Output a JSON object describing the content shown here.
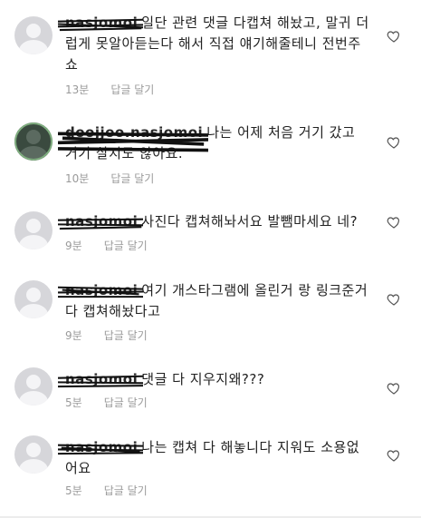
{
  "comments": [
    {
      "username": "nasjomoi",
      "text": "일단 관련 댓글 다캡쳐 해놨고, 말귀 더럽게 못알아듣는다 해서 직접 얘기해줄테니 전번주쇼",
      "time": "13분",
      "reply": "답글 달기",
      "avatar": "default-avatar"
    },
    {
      "username": "doojjoo.nasjomoi",
      "text": "나는 어제 처음 거기 갔고 거기 살지도 않아요.",
      "time": "10분",
      "reply": "답글 달기",
      "avatar": "photo-avatar"
    },
    {
      "username": "nasjomoi",
      "text": "사진다 캡쳐해놔서요 발뺌마세요 네?",
      "time": "9분",
      "reply": "답글 달기",
      "avatar": "default-avatar"
    },
    {
      "username": "nasjomoi",
      "text": "여기 개스타그램에 올린거 랑 링크준거 다 캡쳐해놨다고",
      "time": "9분",
      "reply": "답글 달기",
      "avatar": "default-avatar"
    },
    {
      "username": "nasjomoi",
      "text": "댓글 다 지우지왜???",
      "time": "5분",
      "reply": "답글 달기",
      "avatar": "default-avatar"
    },
    {
      "username": "nasjomoi",
      "text": "나는 캡쳐 다 해놓니다 지워도 소용없어요",
      "time": "5분",
      "reply": "답글 달기",
      "avatar": "default-avatar"
    }
  ],
  "icons": {
    "like": "heart-outline-icon",
    "scribble": "redaction-scribble"
  },
  "colors": {
    "meta": "#9a9a9a",
    "avatar": "#d6d6da",
    "text": "#222222"
  }
}
